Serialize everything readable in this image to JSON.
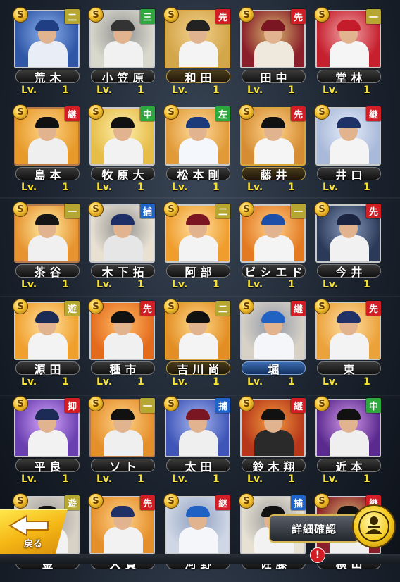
{
  "cards": [
    {
      "name": "荒木",
      "level_label": "Lv.",
      "level": "1",
      "badge": "S",
      "position": "二",
      "pos_color": "olive",
      "rarity": "silver",
      "plate": "dark",
      "bg": "#2f57a6",
      "bg2": "#8fb3ef",
      "uniform": "#e9eef6",
      "cap": "#1f3e83"
    },
    {
      "name": "小笠原",
      "level_label": "Lv.",
      "level": "1",
      "badge": "S",
      "position": "三",
      "pos_color": "green",
      "rarity": "silver",
      "plate": "dark",
      "bg": "#d9d8cc",
      "bg2": "#8f8f8f",
      "uniform": "#f1f1f1",
      "cap": "#333333"
    },
    {
      "name": "和田",
      "level_label": "Lv.",
      "level": "1",
      "badge": "S",
      "position": "先",
      "pos_color": "red",
      "rarity": "gold",
      "plate": "gold",
      "bg": "#d4a64a",
      "bg2": "#f2d18f",
      "uniform": "#f4f4f4",
      "cap": "#222222"
    },
    {
      "name": "田中",
      "level_label": "Lv.",
      "level": "1",
      "badge": "S",
      "position": "先",
      "pos_color": "red",
      "rarity": "silver",
      "plate": "dark",
      "bg": "#8a1e2a",
      "bg2": "#d8b86f",
      "uniform": "#efe9dd",
      "cap": "#7a1622"
    },
    {
      "name": "堂林",
      "level_label": "Lv.",
      "level": "1",
      "badge": "S",
      "position": "一",
      "pos_color": "olive",
      "rarity": "silver",
      "plate": "dark",
      "bg": "#c61f2e",
      "bg2": "#f0a8a8",
      "uniform": "#f5f5f5",
      "cap": "#c41c2a"
    },
    {
      "name": "島本",
      "level_label": "Lv.",
      "level": "1",
      "badge": "S",
      "position": "継",
      "pos_color": "red",
      "rarity": "bronze",
      "plate": "dark",
      "bg": "#e79a2a",
      "bg2": "#ffd58a",
      "uniform": "#efefef",
      "cap": "#111111"
    },
    {
      "name": "牧原大",
      "level_label": "Lv.",
      "level": "1",
      "badge": "S",
      "position": "中",
      "pos_color": "green",
      "rarity": "silver",
      "plate": "dark",
      "bg": "#e6bd47",
      "bg2": "#fff0b0",
      "uniform": "#f2f2f2",
      "cap": "#111111"
    },
    {
      "name": "松本剛",
      "level_label": "Lv.",
      "level": "1",
      "badge": "S",
      "position": "左",
      "pos_color": "green",
      "rarity": "silver",
      "plate": "dark",
      "bg": "#e19a38",
      "bg2": "#ffdda0",
      "uniform": "#f4f7fb",
      "cap": "#1b3a7a"
    },
    {
      "name": "藤井",
      "level_label": "Lv.",
      "level": "1",
      "badge": "S",
      "position": "先",
      "pos_color": "red",
      "rarity": "gold",
      "plate": "gold",
      "bg": "#d68c33",
      "bg2": "#ffd78f",
      "uniform": "#f5f5f5",
      "cap": "#111111"
    },
    {
      "name": "井口",
      "level_label": "Lv.",
      "level": "1",
      "badge": "S",
      "position": "継",
      "pos_color": "red",
      "rarity": "silver",
      "plate": "dark",
      "bg": "#a9b9d9",
      "bg2": "#e7eefb",
      "uniform": "#f4f4f4",
      "cap": "#1f3166"
    },
    {
      "name": "茶谷",
      "level_label": "Lv.",
      "level": "1",
      "badge": "S",
      "position": "一",
      "pos_color": "olive",
      "rarity": "bronze",
      "plate": "dark",
      "bg": "#e79330",
      "bg2": "#fff0a8",
      "uniform": "#f0f0f0",
      "cap": "#151515"
    },
    {
      "name": "木下拓",
      "level_label": "Lv.",
      "level": "1",
      "badge": "S",
      "position": "捕",
      "pos_color": "blue",
      "rarity": "silver",
      "plate": "dark",
      "bg": "#e8e1d2",
      "bg2": "#8f8f8f",
      "uniform": "#e6e6e6",
      "cap": "#1d2f66"
    },
    {
      "name": "阿部",
      "level_label": "Lv.",
      "level": "1",
      "badge": "S",
      "position": "二",
      "pos_color": "olive",
      "rarity": "silver",
      "plate": "dark",
      "bg": "#ef9d2c",
      "bg2": "#ffe1a3",
      "uniform": "#f3f3f3",
      "cap": "#7a1622"
    },
    {
      "name": "ビシエド",
      "level_label": "Lv.",
      "level": "1",
      "badge": "S",
      "position": "一",
      "pos_color": "olive",
      "rarity": "silver",
      "plate": "dark",
      "bg": "#e37a22",
      "bg2": "#ffd18a",
      "uniform": "#f4f4f4",
      "cap": "#1d4fa8"
    },
    {
      "name": "今井",
      "level_label": "Lv.",
      "level": "1",
      "badge": "S",
      "position": "先",
      "pos_color": "red",
      "rarity": "silver",
      "plate": "dark",
      "bg": "#2b3a58",
      "bg2": "#8a9cc0",
      "uniform": "#f1f1f1",
      "cap": "#1b2440"
    },
    {
      "name": "源田",
      "level_label": "Lv.",
      "level": "1",
      "badge": "S",
      "position": "遊",
      "pos_color": "olive",
      "rarity": "silver",
      "plate": "dark",
      "bg": "#f0a02d",
      "bg2": "#ffe2a3",
      "uniform": "#f3f3f3",
      "cap": "#1b2b55"
    },
    {
      "name": "種市",
      "level_label": "Lv.",
      "level": "1",
      "badge": "S",
      "position": "先",
      "pos_color": "red",
      "rarity": "silver",
      "plate": "dark",
      "bg": "#e46b1c",
      "bg2": "#ffbf6a",
      "uniform": "#f0f0f0",
      "cap": "#111111"
    },
    {
      "name": "吉川尚",
      "level_label": "Lv.",
      "level": "1",
      "badge": "S",
      "position": "二",
      "pos_color": "olive",
      "rarity": "gold",
      "plate": "gold",
      "bg": "#e38e24",
      "bg2": "#ffdd8f",
      "uniform": "#f4f4f4",
      "cap": "#111111"
    },
    {
      "name": "堀",
      "level_label": "Lv.",
      "level": "1",
      "badge": "S",
      "position": "継",
      "pos_color": "red",
      "rarity": "silver",
      "plate": "blue",
      "bg": "#d8d2c6",
      "bg2": "#8f97a8",
      "uniform": "#f4f6fa",
      "cap": "#1f62c4"
    },
    {
      "name": "東",
      "level_label": "Lv.",
      "level": "1",
      "badge": "S",
      "position": "先",
      "pos_color": "red",
      "rarity": "silver",
      "plate": "dark",
      "bg": "#eba23a",
      "bg2": "#ffe0a8",
      "uniform": "#f3f3f3",
      "cap": "#1f3166"
    },
    {
      "name": "平良",
      "level_label": "Lv.",
      "level": "1",
      "badge": "S",
      "position": "抑",
      "pos_color": "red",
      "rarity": "silver",
      "plate": "dark",
      "bg": "#6a3fb0",
      "bg2": "#d9a9ff",
      "uniform": "#f2f2f2",
      "cap": "#1b2b55"
    },
    {
      "name": "ソト",
      "level_label": "Lv.",
      "level": "1",
      "badge": "S",
      "position": "一",
      "pos_color": "olive",
      "rarity": "bronze",
      "plate": "dark",
      "bg": "#e58f2a",
      "bg2": "#ffd38c",
      "uniform": "#efefef",
      "cap": "#111111"
    },
    {
      "name": "太田",
      "level_label": "Lv.",
      "level": "1",
      "badge": "S",
      "position": "捕",
      "pos_color": "blue",
      "rarity": "silver",
      "plate": "dark",
      "bg": "#3f56b8",
      "bg2": "#a9b8f0",
      "uniform": "#efefef",
      "cap": "#7a1622"
    },
    {
      "name": "鈴木翔",
      "level_label": "Lv.",
      "level": "1",
      "badge": "S",
      "position": "継",
      "pos_color": "red",
      "rarity": "silver",
      "plate": "dark",
      "bg": "#b7371a",
      "bg2": "#f29b3e",
      "uniform": "#2a2a2a",
      "cap": "#111111"
    },
    {
      "name": "近本",
      "level_label": "Lv.",
      "level": "1",
      "badge": "S",
      "position": "中",
      "pos_color": "green",
      "rarity": "silver",
      "plate": "dark",
      "bg": "#5a2a8f",
      "bg2": "#d49ae8",
      "uniform": "#efefef",
      "cap": "#111111"
    },
    {
      "name": "金",
      "level_label": "",
      "level": "",
      "badge": "S",
      "position": "遊",
      "pos_color": "olive",
      "rarity": "silver",
      "plate": "dark",
      "bg": "#d8d2c6",
      "bg2": "#999999",
      "uniform": "#f2f2f2",
      "cap": "#111111"
    },
    {
      "name": "大貫",
      "level_label": "",
      "level": "",
      "badge": "S",
      "position": "先",
      "pos_color": "red",
      "rarity": "silver",
      "plate": "dark",
      "bg": "#e58f2a",
      "bg2": "#ffd38c",
      "uniform": "#f2f2f2",
      "cap": "#1f3166"
    },
    {
      "name": "河野",
      "level_label": "",
      "level": "",
      "badge": "S",
      "position": "継",
      "pos_color": "red",
      "rarity": "silver",
      "plate": "dark",
      "bg": "#cfd7e6",
      "bg2": "#8f9fc0",
      "uniform": "#f4f6fa",
      "cap": "#1f62c4"
    },
    {
      "name": "佐藤",
      "level_label": "",
      "level": "",
      "badge": "S",
      "position": "捕",
      "pos_color": "blue",
      "rarity": "silver",
      "plate": "dark",
      "bg": "#e6e1d3",
      "bg2": "#999999",
      "uniform": "#f2f2f2",
      "cap": "#111111"
    },
    {
      "name": "横山",
      "level_label": "",
      "level": "",
      "badge": "S",
      "position": "継",
      "pos_color": "red",
      "rarity": "silver",
      "plate": "dark",
      "bg": "#8a1e2a",
      "bg2": "#d8b86f",
      "uniform": "#efefef",
      "cap": "#111111"
    }
  ],
  "buttons": {
    "back_label": "戻る",
    "detail_label": "詳細確認"
  },
  "notification": {
    "count": "!"
  },
  "colors": {
    "level_yellow": "#f5e038",
    "gold_button": "#f5c91c"
  }
}
